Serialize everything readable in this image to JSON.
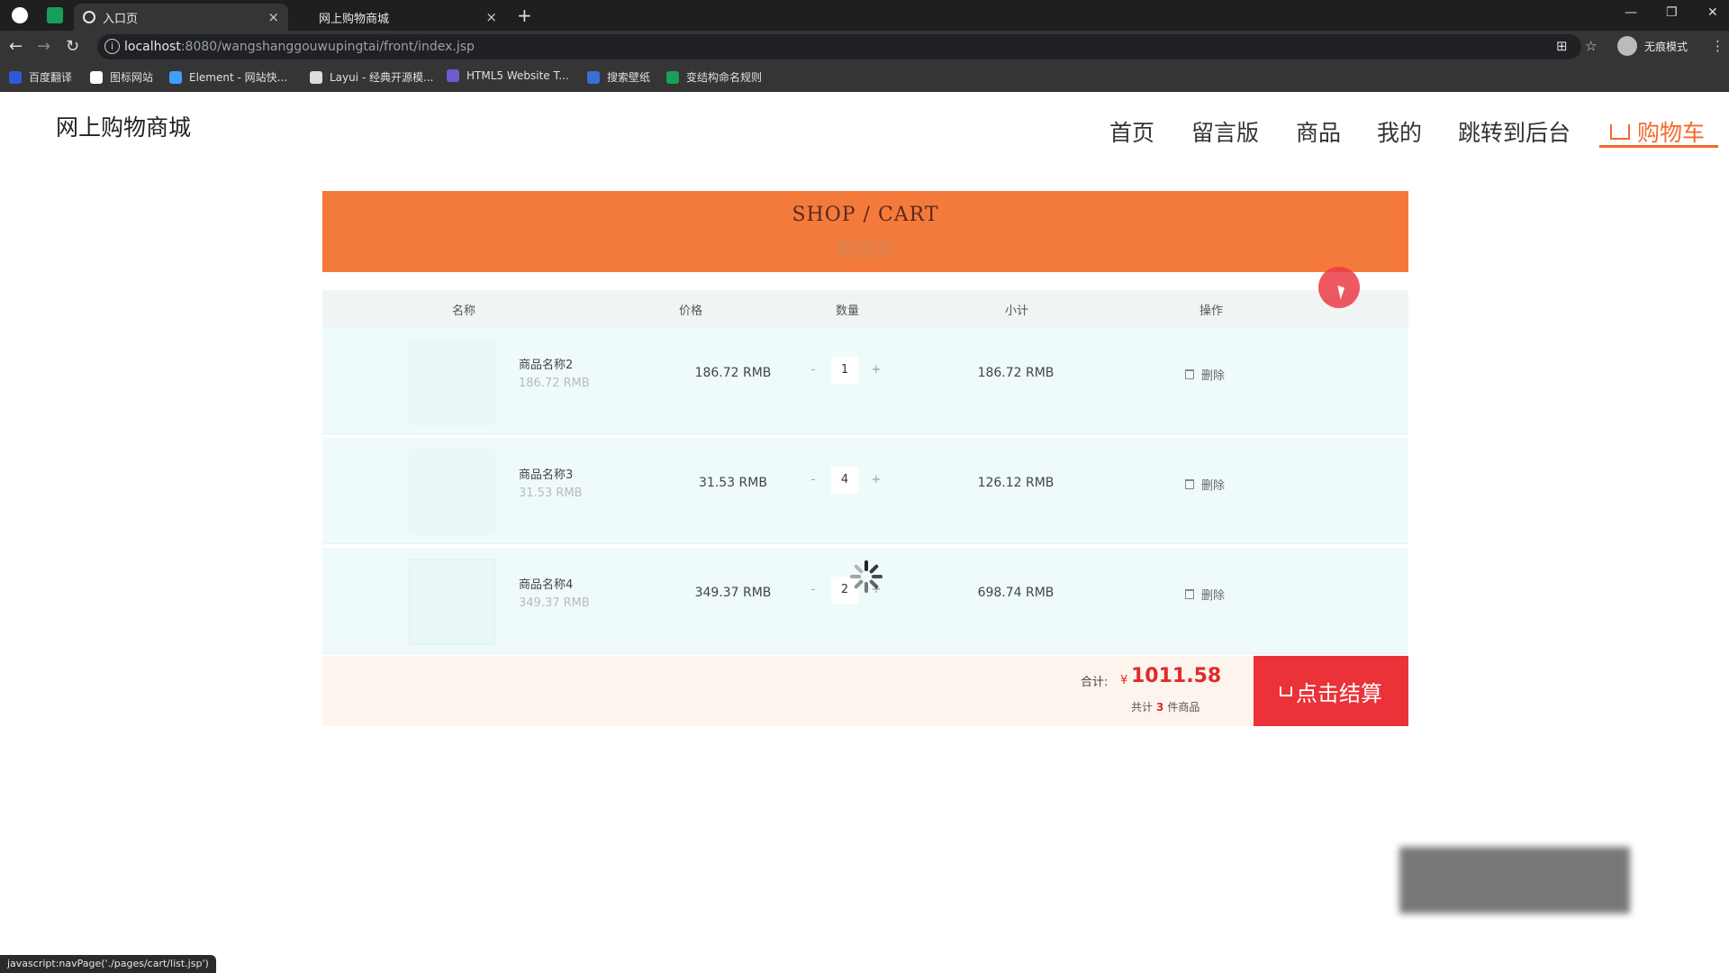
{
  "browser": {
    "tabs": [
      {
        "label": "入口页",
        "active": true
      },
      {
        "label": "网上购物商城",
        "active": false
      }
    ],
    "url_host": "localhost",
    "url_rest": ":8080/wangshanggouwupingtai/front/index.jsp",
    "profile_label": "无痕模式",
    "bookmarks": [
      {
        "label": "百度翻译",
        "color": "#2d5bd8"
      },
      {
        "label": "图标网站",
        "color": "#ffffff"
      },
      {
        "label": "Element - 网站快...",
        "color": "#409eff"
      },
      {
        "label": "Layui - 经典开源模...",
        "color": "#dddddd"
      },
      {
        "label": "HTML5 Website T...",
        "color": "#6d5bd0"
      },
      {
        "label": "搜索壁纸",
        "color": "#3b6fd8"
      },
      {
        "label": "变结构命名规则",
        "color": "#18a058"
      }
    ],
    "status_text": "javascript:navPage('./pages/cart/list.jsp')"
  },
  "site": {
    "title": "网上购物商城",
    "nav": [
      "首页",
      "留言版",
      "商品",
      "我的",
      "跳转到后台",
      "购物车"
    ]
  },
  "banner": {
    "en": "SHOP / CART",
    "cn": "购物车"
  },
  "table": {
    "headers": [
      "名称",
      "价格",
      "数量",
      "小计",
      "操作"
    ],
    "rows": [
      {
        "name": "商品名称2",
        "orig": "186.72 RMB",
        "price": "186.72 RMB",
        "qty": "1",
        "subtotal": "186.72 RMB",
        "action": "删除"
      },
      {
        "name": "商品名称3",
        "orig": "31.53 RMB",
        "price": "31.53 RMB",
        "qty": "4",
        "subtotal": "126.12 RMB",
        "action": "删除"
      },
      {
        "name": "商品名称4",
        "orig": "349.37 RMB",
        "price": "349.37 RMB",
        "qty": "2",
        "subtotal": "698.74 RMB",
        "action": "删除"
      }
    ],
    "minus": "-",
    "plus": "+"
  },
  "footer": {
    "total_label": "合计:",
    "currency": "¥",
    "total": "1011.58",
    "count_prefix": "共计",
    "count": "3",
    "count_suffix": "件商品",
    "checkout_label": "点击结算"
  },
  "colors": {
    "accent": "#f26a2c",
    "banner": "#f47a3c",
    "checkout": "#ea3238"
  }
}
